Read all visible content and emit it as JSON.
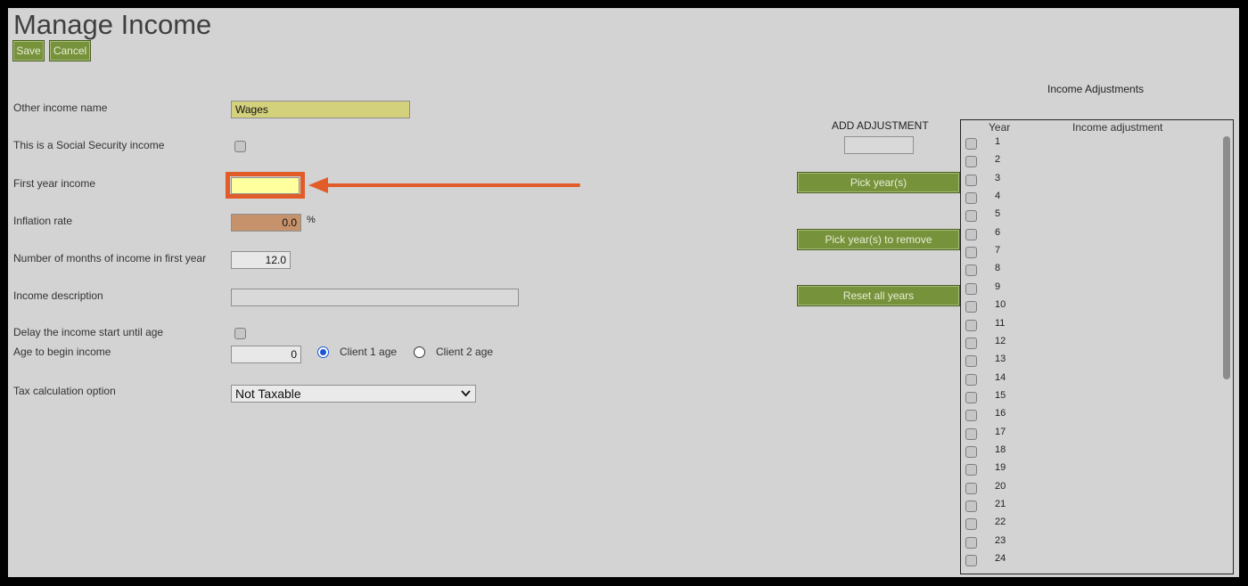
{
  "page": {
    "title": "Manage Income",
    "save_label": "Save",
    "cancel_label": "Cancel"
  },
  "form": {
    "other_income_name": {
      "label": "Other income name",
      "value": "Wages"
    },
    "social_security": {
      "label": "This is a Social Security income",
      "checked": false
    },
    "first_year_income": {
      "label": "First year income",
      "value": ""
    },
    "inflation_rate": {
      "label": "Inflation rate",
      "value": "0.0",
      "unit": "%"
    },
    "months_first_year": {
      "label": "Number of months of income in first year",
      "value": "12.0"
    },
    "income_description": {
      "label": "Income description",
      "value": ""
    },
    "delay_start": {
      "label": "Delay the income start until age",
      "checked": false
    },
    "age_to_begin": {
      "label": "Age to begin income",
      "value": "0",
      "options": [
        "Client 1 age",
        "Client 2 age"
      ],
      "selected": "Client 1 age"
    },
    "tax_option": {
      "label": "Tax calculation option",
      "value": "Not Taxable"
    }
  },
  "adjustments": {
    "section_title": "Income Adjustments",
    "add_label": "ADD ADJUSTMENT",
    "add_value": "",
    "pick_years_label": "Pick year(s)",
    "pick_remove_label": "Pick year(s) to remove",
    "reset_label": "Reset all years",
    "columns": [
      "Year",
      "Income adjustment"
    ],
    "years": [
      "1",
      "2",
      "3",
      "4",
      "5",
      "6",
      "7",
      "8",
      "9",
      "10",
      "11",
      "12",
      "13",
      "14",
      "15",
      "16",
      "17",
      "18",
      "19",
      "20",
      "21",
      "22",
      "23",
      "24"
    ]
  },
  "colors": {
    "accent_green": "#76933c",
    "highlight_orange": "#e25c29",
    "name_field": "#d4d17d",
    "income_field": "#ffff9e",
    "inflation_field": "#c6926b"
  }
}
